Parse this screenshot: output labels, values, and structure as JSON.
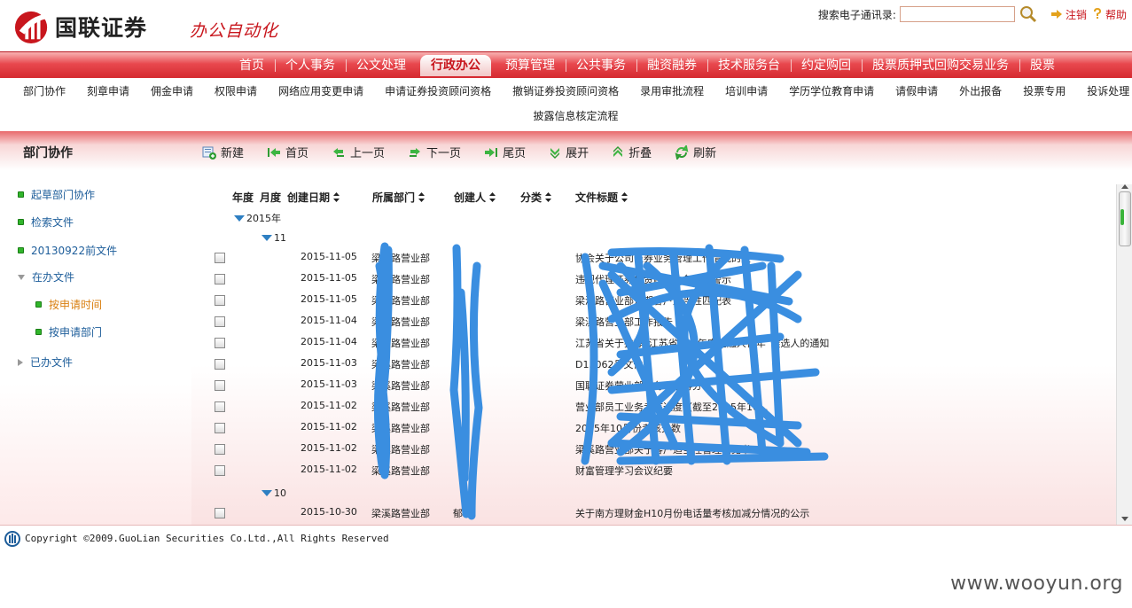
{
  "header": {
    "company_name": "国联证券",
    "system_name": "办公自动化",
    "search_label": "搜索电子通讯录:",
    "search_value": "",
    "logout_label": "注销",
    "help_label": "帮助"
  },
  "main_nav": {
    "items": [
      "首页",
      "个人事务",
      "公文处理",
      "行政办公",
      "预算管理",
      "公共事务",
      "融资融券",
      "技术服务台",
      "约定购回",
      "股票质押式回购交易业务",
      "股票"
    ],
    "active": "行政办公"
  },
  "sub_nav": {
    "row1": [
      "部门协作",
      "刻章申请",
      "佣金申请",
      "权限申请",
      "网络应用变更申请",
      "申请证券投资顾问资格",
      "撤销证券投资顾问资格",
      "录用审批流程",
      "培训申请",
      "学历学位教育申请",
      "请假申请",
      "外出报备",
      "投票专用",
      "投诉处理"
    ],
    "row2": [
      "披露信息核定流程"
    ]
  },
  "section": {
    "title": "部门协作"
  },
  "toolbar": {
    "new": "新建",
    "first": "首页",
    "prev": "上一页",
    "next": "下一页",
    "last": "尾页",
    "expand": "展开",
    "collapse": "折叠",
    "refresh": "刷新"
  },
  "sidebar": {
    "draft": "起草部门协作",
    "search": "检索文件",
    "before": "20130922前文件",
    "in_progress": "在办文件",
    "by_time": "按申请时间",
    "by_dept": "按申请部门",
    "done": "已办文件"
  },
  "table": {
    "columns": {
      "year": "年度",
      "month": "月度",
      "created": "创建日期",
      "dept": "所属部门",
      "creator": "创建人",
      "category": "分类",
      "title": "文件标题"
    },
    "group_year": "2015年",
    "group_month_1": "11",
    "group_month_2": "10",
    "rows": [
      {
        "date": "2015-11-05",
        "dept": "梁溪路营业部",
        "creator": "",
        "title": "协会关于公司证券业务管理工作情况的报"
      },
      {
        "date": "2015-11-05",
        "dept": "梁溪路营业部",
        "creator": "",
        "title": "违规代理证券投资顾问业务案例警示"
      },
      {
        "date": "2015-11-05",
        "dept": "梁溪路营业部",
        "creator": "",
        "title": "梁溪路营业部近期客户适当性匹配表"
      },
      {
        "date": "2015-11-04",
        "dept": "梁溪路营业部",
        "creator": "",
        "title": "梁溪路营业部工作报告"
      },
      {
        "date": "2015-11-04",
        "dept": "梁溪路营业部",
        "creator": "",
        "title": "江苏省关于推荐“江苏省十大年度金融人物年”候选人的通知"
      },
      {
        "date": "2015-11-03",
        "dept": "梁溪路营业部",
        "creator": "",
        "title": "D15062号文件"
      },
      {
        "date": "2015-11-03",
        "dept": "梁溪路营业部",
        "creator": "",
        "title": "国联证券营业部业务考核得分"
      },
      {
        "date": "2015-11-02",
        "dept": "梁溪路营业部",
        "creator": "",
        "title": "营业部员工业务考核进度（截至2015年10..."
      },
      {
        "date": "2015-11-02",
        "dept": "梁溪路营业部",
        "creator": "",
        "title": "2015年10月份考核分数"
      },
      {
        "date": "2015-11-02",
        "dept": "梁溪路营业部",
        "creator": "",
        "title": "梁溪路营业部关于客户适当性管理意见书"
      },
      {
        "date": "2015-11-02",
        "dept": "梁溪路营业部",
        "creator": "",
        "title": "财富管理学习会议纪要"
      },
      {
        "date": "2015-10-30",
        "dept": "梁溪路营业部",
        "creator": "郁",
        "title": "关于南方理财金H10月份电话量考核加减分情况的公示"
      }
    ]
  },
  "footer": {
    "copyright": "Copyright ©2009.GuoLian Securities Co.Ltd.,All Rights Reserved"
  },
  "watermark": "www.wooyun.org",
  "colors": {
    "brand_red": "#c8161d",
    "nav_red": "#e8484e",
    "link_blue": "#1d5d9a",
    "selected_orange": "#d97f10",
    "scribble_blue": "#3a8ee0"
  }
}
